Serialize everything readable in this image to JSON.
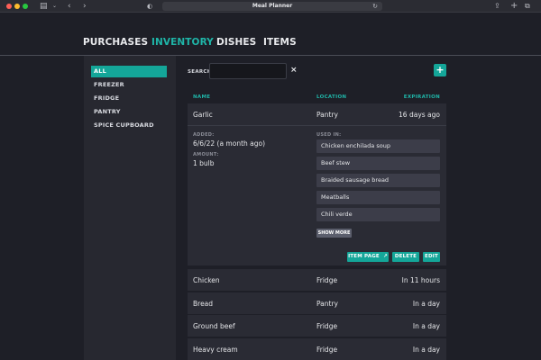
{
  "window": {
    "title": "Meal Planner"
  },
  "nav": {
    "tabs": [
      {
        "label": "PURCHASES"
      },
      {
        "label": "INVENTORY"
      },
      {
        "label": "DISHES"
      },
      {
        "label": "ITEMS"
      }
    ],
    "active": "INVENTORY"
  },
  "sidebar": {
    "items": [
      {
        "label": "ALL"
      },
      {
        "label": "FREEZER"
      },
      {
        "label": "FRIDGE"
      },
      {
        "label": "PANTRY"
      },
      {
        "label": "SPICE CUPBOARD"
      }
    ],
    "active": "ALL"
  },
  "search": {
    "label": "SEARCH",
    "value": "",
    "clear_icon": "×"
  },
  "add_button": "+",
  "table": {
    "headers": {
      "name": "NAME",
      "location": "LOCATION",
      "expiration": "EXPIRATION"
    },
    "expanded": {
      "name": "Garlic",
      "location": "Pantry",
      "expiration": "16 days ago",
      "added_label": "ADDED:",
      "added_value": "6/6/22 (a month ago)",
      "amount_label": "AMOUNT:",
      "amount_value": "1 bulb",
      "used_in_label": "USED IN:",
      "used_in": [
        "Chicken enchilada soup",
        "Beef stew",
        "Braided sausage bread",
        "Meatballs",
        "Chili verde"
      ],
      "show_more": "SHOW MORE",
      "item_page": "ITEM PAGE",
      "delete": "DELETE",
      "edit": "EDIT"
    },
    "rows": [
      {
        "name": "Chicken",
        "location": "Fridge",
        "expiration": "In 11 hours"
      },
      {
        "name": "Bread",
        "location": "Pantry",
        "expiration": "In a day"
      },
      {
        "name": "Ground beef",
        "location": "Fridge",
        "expiration": "In a day"
      },
      {
        "name": "Heavy cream",
        "location": "Fridge",
        "expiration": "In a day"
      }
    ]
  },
  "colors": {
    "accent": "#14a699",
    "accent_text": "#1fb5a8",
    "background": "#1e1f27",
    "panel": "#2a2b34"
  }
}
